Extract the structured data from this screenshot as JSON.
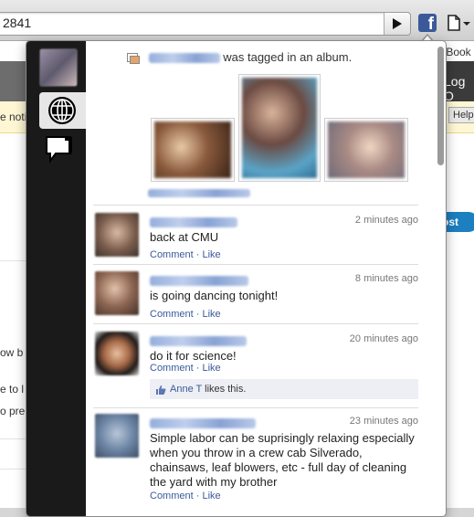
{
  "browser": {
    "url_text": "2841",
    "go_icon": "play-icon",
    "facebook_icon": "facebook-icon",
    "page_menu_icon": "page-menu-icon"
  },
  "background_page": {
    "book_text": "r Book",
    "logout_text": "Log O",
    "help_label": "Help",
    "notice_text": "e noti",
    "post_label": "ost",
    "line1": "ow b",
    "line2": "e to l",
    "line3": "o pre"
  },
  "sidebar": {
    "items": [
      {
        "name": "avatar"
      },
      {
        "name": "globe-icon"
      },
      {
        "name": "chat-bubble-icon"
      }
    ]
  },
  "tag_story": {
    "text": "was tagged in an album.",
    "icon": "photo-album-icon"
  },
  "stories": [
    {
      "time": "2 minutes ago",
      "message": "back at CMU",
      "comment": "Comment",
      "like": "Like"
    },
    {
      "time": "8 minutes ago",
      "message": "is going dancing tonight!",
      "comment": "Comment",
      "like": "Like"
    },
    {
      "time": "20 minutes ago",
      "message": "do it for science!",
      "comment": "Comment",
      "like": "Like",
      "likes_name": "Anne T",
      "likes_text": "likes this."
    },
    {
      "time": "23 minutes ago",
      "message": "Simple labor can be suprisingly relaxing especially when you throw in a crew cab Silverado, chainsaws, leaf blowers, etc - full day of cleaning the yard with my brother",
      "comment": "Comment",
      "like": "Like"
    }
  ],
  "separator": "·",
  "colors": {
    "facebook_blue": "#3b5998",
    "rail": "#1a1a1a",
    "likes_bg": "#edeff4"
  }
}
